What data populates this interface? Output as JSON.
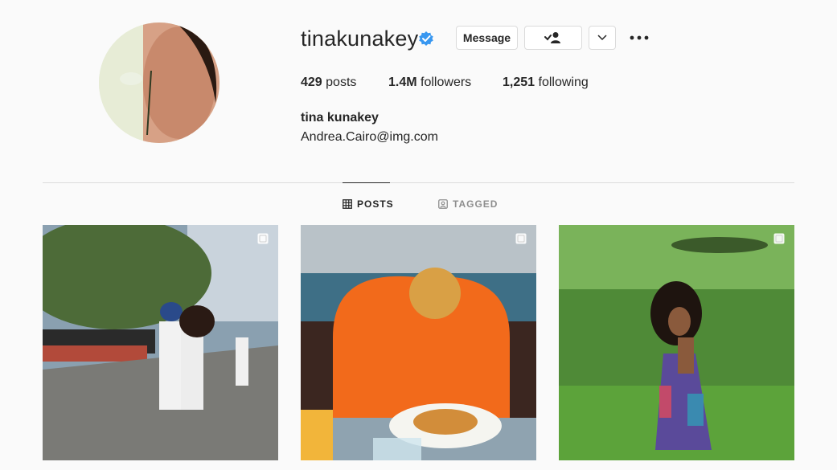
{
  "profile": {
    "username": "tinakunakey",
    "verified": true,
    "full_name": "tina kunakey",
    "bio": "Andrea.Cairo@img.com"
  },
  "actions": {
    "message_label": "Message",
    "follow_icon": "person-check-icon",
    "more_icon": "chevron-down-icon",
    "options_icon": "more-horizontal-icon"
  },
  "stats": {
    "posts_count": "429",
    "posts_label": "posts",
    "followers_count": "1.4M",
    "followers_label": "followers",
    "following_count": "1,251",
    "following_label": "following"
  },
  "tabs": [
    {
      "label": "POSTS",
      "icon": "grid-icon",
      "active": true
    },
    {
      "label": "TAGGED",
      "icon": "tag-icon",
      "active": false
    }
  ],
  "posts": [
    {
      "type": "carousel",
      "icon": "carousel-icon"
    },
    {
      "type": "carousel",
      "icon": "carousel-icon"
    },
    {
      "type": "carousel",
      "icon": "carousel-icon"
    }
  ],
  "colors": {
    "background": "#fafafa",
    "verified_blue": "#3897f0",
    "divider": "#dbdbdb",
    "muted": "#8e8e8e"
  }
}
